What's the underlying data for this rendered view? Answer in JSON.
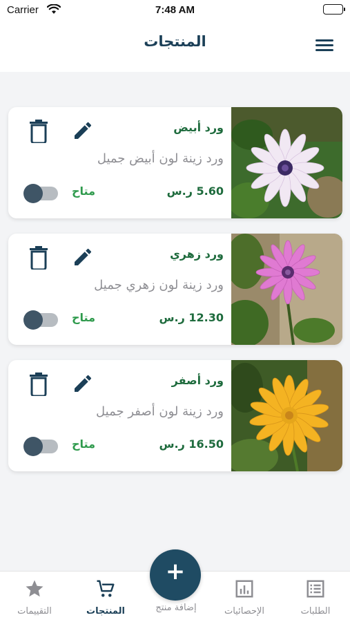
{
  "status_bar": {
    "carrier": "Carrier",
    "time": "7:48 AM"
  },
  "header": {
    "title": "المنتجات",
    "menu_icon": "hamburger-menu-icon"
  },
  "products": [
    {
      "name": "ورد أبيض",
      "description": "ورد زينة لون أبيض جميل",
      "price": "5.60 ر.س",
      "availability": "متاح",
      "available": false,
      "image": "white-daisy-flower",
      "petal_color": "#f1e8f3",
      "center_color": "#3b2a63",
      "bg_color": "#3d6b2c"
    },
    {
      "name": "ورد زهري",
      "description": "ورد زينة لون زهري جميل",
      "price": "12.30 ر.س",
      "availability": "متاح",
      "available": false,
      "image": "pink-daisy-flower",
      "petal_color": "#e07ad2",
      "center_color": "#5a2c6e",
      "bg_color": "#8b7a5c"
    },
    {
      "name": "ورد أصفر",
      "description": "ورد زينة لون أصفر جميل",
      "price": "16.50 ر.س",
      "availability": "متاح",
      "available": false,
      "image": "yellow-daisy-flower",
      "petal_color": "#f4b322",
      "center_color": "#e5a61b",
      "bg_color": "#3e5b26"
    }
  ],
  "tab_bar": {
    "tabs": [
      {
        "label": "الطلبات",
        "icon": "orders-list-icon",
        "active": false
      },
      {
        "label": "الإحصائيات",
        "icon": "statistics-chart-icon",
        "active": false
      },
      {
        "label": "المنتجات",
        "icon": "cart-icon",
        "active": true
      },
      {
        "label": "التقييمات",
        "icon": "star-icon",
        "active": false
      }
    ],
    "add_button": {
      "label": "إضافة منتج",
      "symbol": "+",
      "icon": "plus-icon"
    }
  },
  "colors": {
    "primary": "#1b3f57",
    "green_text": "#1e6b3d",
    "available_green": "#2e9a4c",
    "muted_text": "#8e8e93",
    "background": "#f3f4f6"
  }
}
